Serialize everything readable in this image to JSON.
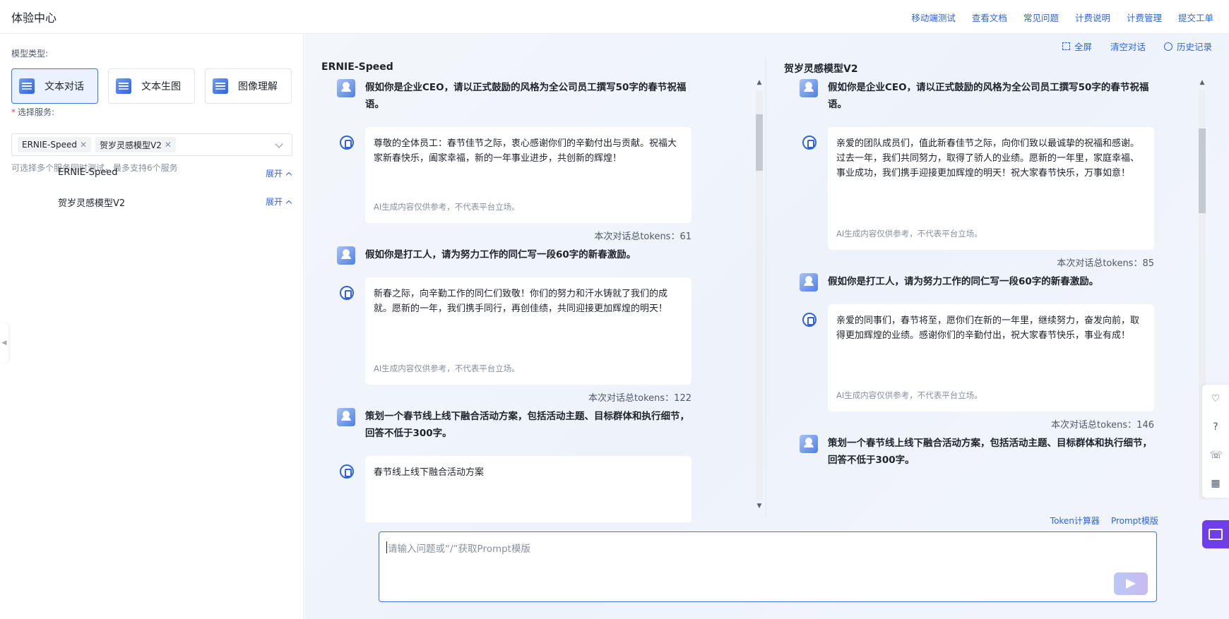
{
  "header": {
    "title": "体验中心",
    "nav": [
      "移动端测试",
      "查看文档",
      "常见问题",
      "计费说明",
      "计费管理",
      "提交工单"
    ]
  },
  "sidebar": {
    "model_type_label": "模型类型:",
    "model_types": [
      {
        "label": "文本对话",
        "active": true
      },
      {
        "label": "文本生图",
        "active": false
      },
      {
        "label": "图像理解",
        "active": false
      }
    ],
    "service_label": "选择服务:",
    "selected_services": [
      "ERNIE-Speed",
      "贺岁灵感模型V2"
    ],
    "service_hint": "可选择多个服务同时测试，最多支持6个服务",
    "services": [
      {
        "name": "ERNIE-Speed",
        "expand_label": "展开"
      },
      {
        "name": "贺岁灵感模型V2",
        "expand_label": "展开"
      }
    ]
  },
  "toolbar": {
    "fullscreen": "全屏",
    "clear": "清空对话",
    "history": "历史记录"
  },
  "columns": [
    {
      "title": "ERNIE-Speed",
      "turns": [
        {
          "question": "假如你是企业CEO，请以正式鼓励的风格为全公司员工撰写50字的春节祝福语。",
          "answer": "尊敬的全体员工：春节佳节之际，衷心感谢你们的辛勤付出与贡献。祝福大家新春快乐，阖家幸福，新的一年事业进步，共创新的辉煌！",
          "disclaimer": "AI生成内容仅供参考，不代表平台立场。",
          "tokens": "本次对话总tokens：61"
        },
        {
          "question": "假如你是打工人，请为努力工作的同仁写一段60字的新春激励。",
          "answer": "新春之际，向辛勤工作的同仁们致敬！你们的努力和汗水铸就了我们的成就。愿新的一年，我们携手同行，再创佳绩，共同迎接更加辉煌的明天！",
          "disclaimer": "AI生成内容仅供参考，不代表平台立场。",
          "tokens": "本次对话总tokens：122"
        },
        {
          "question": "策划一个春节线上线下融合活动方案，包括活动主题、目标群体和执行细节，回答不低于300字。",
          "answer": "春节线上线下融合活动方案",
          "disclaimer": "",
          "tokens": ""
        }
      ]
    },
    {
      "title": "贺岁灵感模型V2",
      "turns": [
        {
          "question": "假如你是企业CEO，请以正式鼓励的风格为全公司员工撰写50字的春节祝福语。",
          "answer": "亲爱的团队成员们，值此新春佳节之际，向你们致以最诚挚的祝福和感谢。过去一年，我们共同努力，取得了骄人的业绩。愿新的一年里，家庭幸福、事业成功，我们携手迎接更加辉煌的明天！祝大家春节快乐，万事如意！",
          "disclaimer": "AI生成内容仅供参考，不代表平台立场。",
          "tokens": "本次对话总tokens：85"
        },
        {
          "question": "假如你是打工人，请为努力工作的同仁写一段60字的新春激励。",
          "answer": "亲爱的同事们，春节将至，愿你们在新的一年里，继续努力，奋发向前，取得更加辉煌的业绩。感谢你们的辛勤付出，祝大家春节快乐，事业有成！",
          "disclaimer": "AI生成内容仅供参考，不代表平台立场。",
          "tokens": "本次对话总tokens：146"
        },
        {
          "question": "策划一个春节线上线下融合活动方案，包括活动主题、目标群体和执行细节，回答不低于300字。",
          "answer": "",
          "disclaimer": "",
          "tokens": ""
        }
      ]
    }
  ],
  "composer": {
    "token_calc": "Token计算器",
    "prompt_template": "Prompt模版",
    "placeholder": "请输入问题或“/”获取Prompt模版"
  },
  "colors": {
    "accent": "#2b66e0",
    "fab": "#6f3ee8"
  }
}
